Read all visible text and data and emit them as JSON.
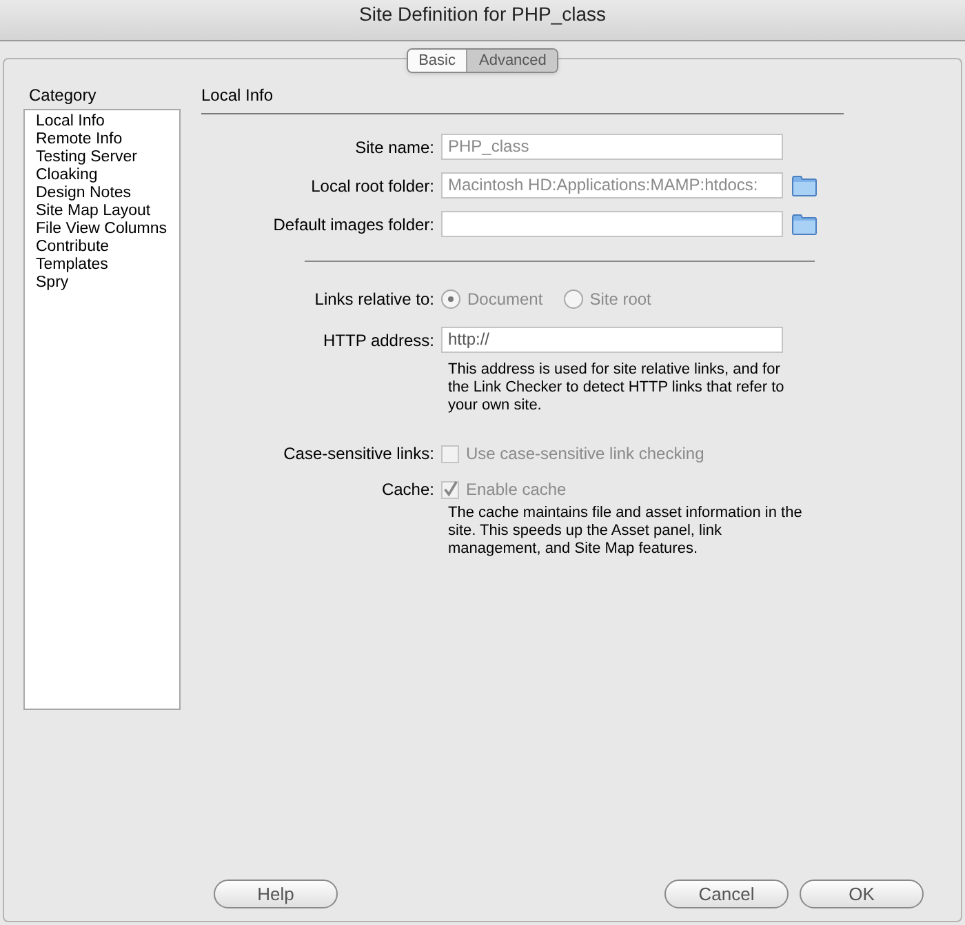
{
  "window": {
    "title": "Site Definition for PHP_class"
  },
  "tabs": [
    {
      "label": "Basic",
      "selected": false
    },
    {
      "label": "Advanced",
      "selected": true
    }
  ],
  "category": {
    "title": "Category",
    "items": [
      "Local Info",
      "Remote Info",
      "Testing Server",
      "Cloaking",
      "Design Notes",
      "Site Map Layout",
      "File View Columns",
      "Contribute",
      "Templates",
      "Spry"
    ]
  },
  "section": {
    "title": "Local Info"
  },
  "fields": [
    {
      "label": "Site name:",
      "value": "PHP_class",
      "folder": false
    },
    {
      "label": "Local root folder:",
      "value": "Macintosh HD:Applications:MAMP:htdocs:",
      "folder": true
    },
    {
      "label": "Default images folder:",
      "folder": true
    }
  ],
  "links_relative": {
    "label": "Links relative to:",
    "options": [
      {
        "label": "Document",
        "selected": true
      },
      {
        "label": "Site root",
        "selected": false
      }
    ]
  },
  "http": {
    "label": "HTTP address:",
    "value": "http://",
    "note": "This address is used for site relative links, and for the Link Checker to detect HTTP links that refer to your own site."
  },
  "checks": [
    {
      "label": "Case-sensitive links:",
      "text": "Use case-sensitive link checking",
      "checked": false,
      "disabled": true
    },
    {
      "label": "Cache:",
      "text": "Enable cache",
      "checked": true,
      "disabled": true,
      "note": "The cache maintains file and asset information in the site.  This speeds up the Asset panel, link management, and Site Map features."
    }
  ],
  "buttons": {
    "left": [
      "Help"
    ],
    "right": [
      "Cancel",
      "OK"
    ]
  }
}
